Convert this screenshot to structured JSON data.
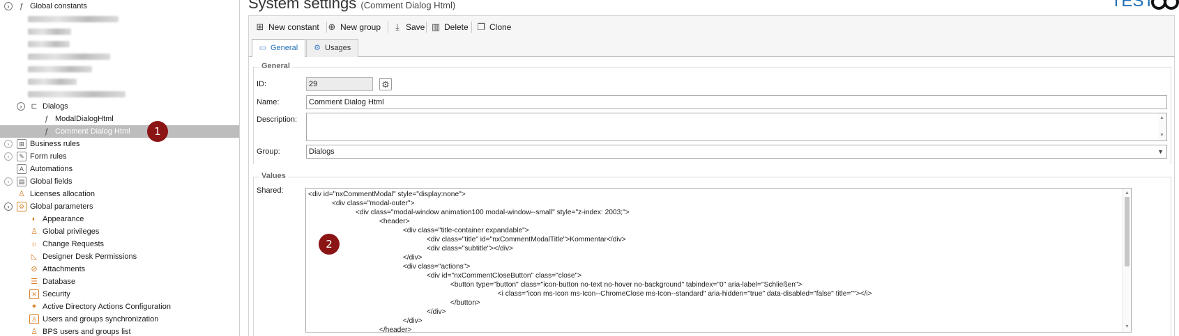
{
  "tree": {
    "root_label": "Global constants",
    "dialogs_label": "Dialogs",
    "modal_dialog_label": "ModalDialogHtml",
    "comment_dialog_label": "Comment Dialog Html",
    "nodes": [
      {
        "label": "Business rules"
      },
      {
        "label": "Form rules"
      },
      {
        "label": "Automations"
      },
      {
        "label": "Global fields"
      },
      {
        "label": "Licenses allocation"
      },
      {
        "label": "Global parameters"
      }
    ],
    "params": [
      {
        "label": "Appearance"
      },
      {
        "label": "Global privileges"
      },
      {
        "label": "Change Requests"
      },
      {
        "label": "Designer Desk Permissions"
      },
      {
        "label": "Attachments"
      },
      {
        "label": "Database"
      },
      {
        "label": "Security"
      },
      {
        "label": "Active Directory Actions Configuration"
      },
      {
        "label": "Users and groups synchronization"
      },
      {
        "label": "BPS users and groups list"
      }
    ]
  },
  "badges": {
    "one": "1",
    "two": "2"
  },
  "header": {
    "title": "System settings",
    "subtitle": "(Comment Dialog Html)",
    "brand": "TEST"
  },
  "toolbar": {
    "new_constant": "New constant",
    "new_group": "New group",
    "save": "Save",
    "delete": "Delete",
    "clone": "Clone"
  },
  "tabs": {
    "general": "General",
    "usages": "Usages"
  },
  "general": {
    "legend": "General",
    "id_label": "ID:",
    "id_value": "29",
    "name_label": "Name:",
    "name_value": "Comment Dialog Html",
    "description_label": "Description:",
    "description_value": "",
    "group_label": "Group:",
    "group_value": "Dialogs"
  },
  "values": {
    "legend": "Values",
    "shared_label": "Shared:",
    "code_lines": [
      "<div id=\"nxCommentModal\" style=\"display:none\">",
      "            <div class=\"modal-outer\">",
      "                        <div class=\"modal-window animation100 modal-window--small\" style=\"z-index: 2003;\">",
      "                                    <header>",
      "                                                <div class=\"title-container expandable\">",
      "                                                            <div class=\"title\" id=\"nxCommentModalTitle\">Kommentar</div>",
      "                                                            <div class=\"subtitle\"></div>",
      "                                                </div>",
      "                                                <div class=\"actions\">",
      "                                                            <div id=\"nxCommentCloseButton\" class=\"close\">",
      "                                                                        <button type=\"button\" class=\"icon-button no-text no-hover no-background\" tabindex=\"0\" aria-label=\"Schließen\">",
      "                                                                                                <i class=\"icon ms-Icon ms-Icon--ChromeClose ms-Icon--standard\" aria-hidden=\"true\" data-disabled=\"false\" title=\"\"></i>",
      "                                                                        </button>",
      "                                                            </div>",
      "                                                </div>",
      "                                    </header>"
    ]
  }
}
